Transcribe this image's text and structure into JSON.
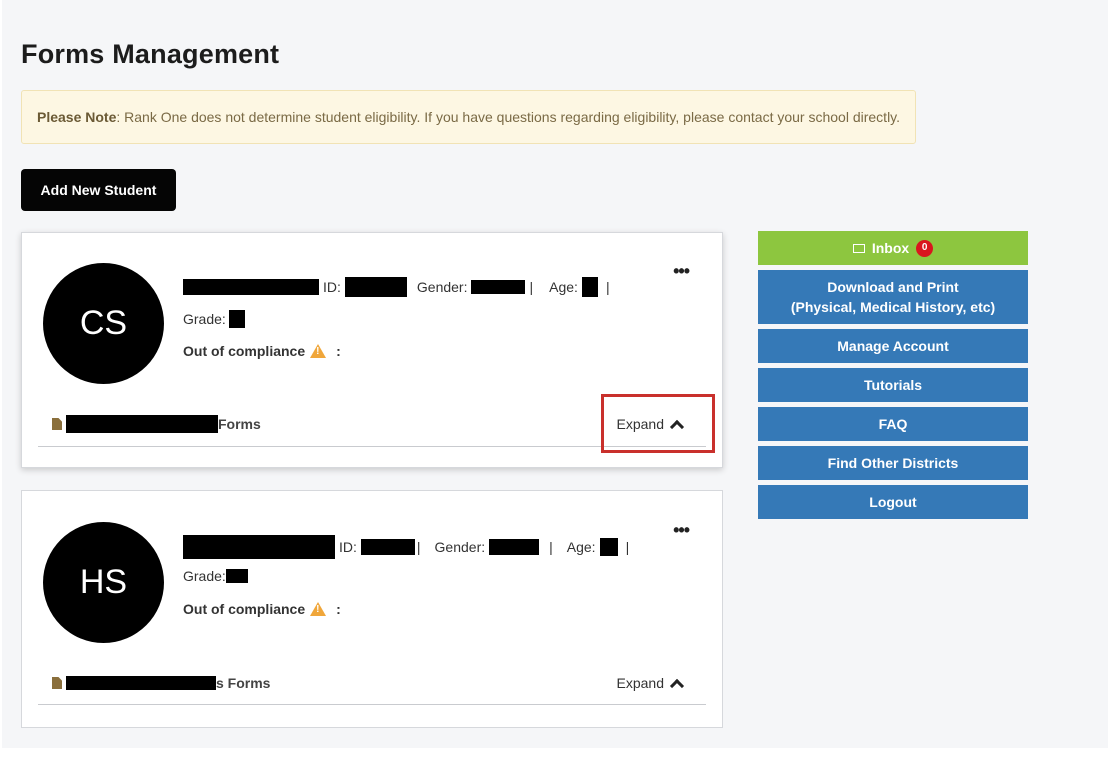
{
  "page": {
    "title": "Forms Management"
  },
  "note": {
    "label": "Please Note",
    "text": ": Rank One does not determine student eligibility. If you have questions regarding eligibility, please contact your school directly."
  },
  "add_student_label": "Add New Student",
  "students": [
    {
      "initials": "CS",
      "id_label": "ID:",
      "gender_label": "Gender:",
      "age_label": "Age:",
      "grade_label": "Grade:",
      "compliance_label": "Out of compliance",
      "compliance_suffix": ":",
      "forms_label": "Forms",
      "expand_label": "Expand"
    },
    {
      "initials": "HS",
      "id_label": "ID:",
      "gender_label": "Gender:",
      "age_label": "Age:",
      "grade_label": "Grade:",
      "compliance_label": "Out of compliance",
      "compliance_suffix": ":",
      "forms_label": "s Forms",
      "expand_label": "Expand"
    }
  ],
  "sidebar": {
    "inbox_label": "Inbox",
    "inbox_count": "0",
    "download_line1": "Download and Print",
    "download_line2": "(Physical, Medical History, etc)",
    "manage_account": "Manage Account",
    "tutorials": "Tutorials",
    "faq": "FAQ",
    "find_districts": "Find Other Districts",
    "logout": "Logout"
  },
  "colors": {
    "inbox": "#8dc63f",
    "sidebar_blue": "#3579b7",
    "badge": "#d9161e",
    "highlight": "#c9302c"
  },
  "icons": [
    "envelope-icon",
    "document-icon",
    "warning-icon",
    "more-icon",
    "chevron-up-icon"
  ]
}
